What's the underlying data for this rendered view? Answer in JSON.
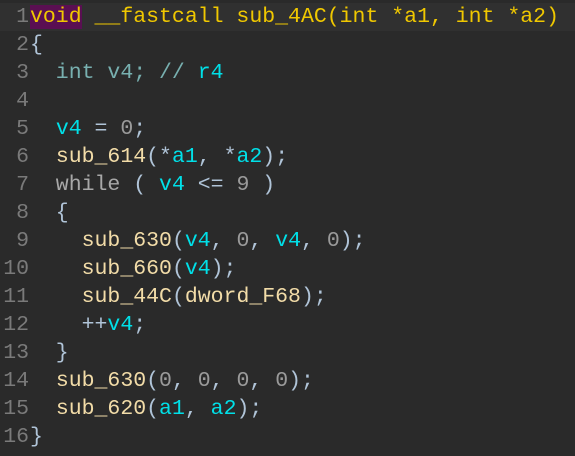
{
  "colors": {
    "background": "#2a2a2a",
    "line_number": "#7a7a7a",
    "keyword_highlight_bg": "#5a0f52",
    "declaration": "#f0c800",
    "variable": "#00e0e8",
    "function": "#f2dca8"
  },
  "lines": [
    {
      "n": "1",
      "tokens": [
        [
          "void",
          "kw-hl"
        ],
        [
          " __fastcall sub_4AC(int *a1, int *a2)",
          "decl"
        ]
      ]
    },
    {
      "n": "2",
      "tokens": [
        [
          "{",
          "punct"
        ]
      ]
    },
    {
      "n": "3",
      "tokens": [
        [
          "  int v4; // ",
          "type"
        ],
        [
          "r4",
          "var"
        ]
      ]
    },
    {
      "n": "4",
      "tokens": []
    },
    {
      "n": "5",
      "tokens": [
        [
          "  ",
          "punct"
        ],
        [
          "v4",
          "var"
        ],
        [
          " = ",
          "punct"
        ],
        [
          "0",
          "num"
        ],
        [
          ";",
          "punct"
        ]
      ]
    },
    {
      "n": "6",
      "tokens": [
        [
          "  ",
          "punct"
        ],
        [
          "sub_614",
          "func"
        ],
        [
          "(*",
          "punct"
        ],
        [
          "a1",
          "var"
        ],
        [
          ", *",
          "punct"
        ],
        [
          "a2",
          "var"
        ],
        [
          ");",
          "punct"
        ]
      ]
    },
    {
      "n": "7",
      "tokens": [
        [
          "  while",
          "keyword"
        ],
        [
          " ( ",
          "punct"
        ],
        [
          "v4",
          "var"
        ],
        [
          " <= ",
          "punct"
        ],
        [
          "9",
          "num"
        ],
        [
          " )",
          "punct"
        ]
      ]
    },
    {
      "n": "8",
      "tokens": [
        [
          "  {",
          "punct"
        ]
      ]
    },
    {
      "n": "9",
      "tokens": [
        [
          "    ",
          "punct"
        ],
        [
          "sub_630",
          "func"
        ],
        [
          "(",
          "punct"
        ],
        [
          "v4",
          "var"
        ],
        [
          ", ",
          "punct"
        ],
        [
          "0",
          "num"
        ],
        [
          ", ",
          "punct"
        ],
        [
          "v4",
          "var"
        ],
        [
          ", ",
          "punct"
        ],
        [
          "0",
          "num"
        ],
        [
          ");",
          "punct"
        ]
      ]
    },
    {
      "n": "10",
      "tokens": [
        [
          "    ",
          "punct"
        ],
        [
          "sub_660",
          "func"
        ],
        [
          "(",
          "punct"
        ],
        [
          "v4",
          "var"
        ],
        [
          ");",
          "punct"
        ]
      ]
    },
    {
      "n": "11",
      "tokens": [
        [
          "    ",
          "punct"
        ],
        [
          "sub_44C",
          "func"
        ],
        [
          "(",
          "punct"
        ],
        [
          "dword_F68",
          "glob"
        ],
        [
          ");",
          "punct"
        ]
      ]
    },
    {
      "n": "12",
      "tokens": [
        [
          "    ++",
          "punct"
        ],
        [
          "v4",
          "var"
        ],
        [
          ";",
          "punct"
        ]
      ]
    },
    {
      "n": "13",
      "tokens": [
        [
          "  }",
          "punct"
        ]
      ]
    },
    {
      "n": "14",
      "tokens": [
        [
          "  ",
          "punct"
        ],
        [
          "sub_630",
          "func"
        ],
        [
          "(",
          "punct"
        ],
        [
          "0",
          "num"
        ],
        [
          ", ",
          "punct"
        ],
        [
          "0",
          "num"
        ],
        [
          ", ",
          "punct"
        ],
        [
          "0",
          "num"
        ],
        [
          ", ",
          "punct"
        ],
        [
          "0",
          "num"
        ],
        [
          ");",
          "punct"
        ]
      ]
    },
    {
      "n": "15",
      "tokens": [
        [
          "  ",
          "punct"
        ],
        [
          "sub_620",
          "func"
        ],
        [
          "(",
          "punct"
        ],
        [
          "a1",
          "var"
        ],
        [
          ", ",
          "punct"
        ],
        [
          "a2",
          "var"
        ],
        [
          ");",
          "punct"
        ]
      ]
    },
    {
      "n": "16",
      "tokens": [
        [
          "}",
          "punct"
        ]
      ]
    }
  ]
}
